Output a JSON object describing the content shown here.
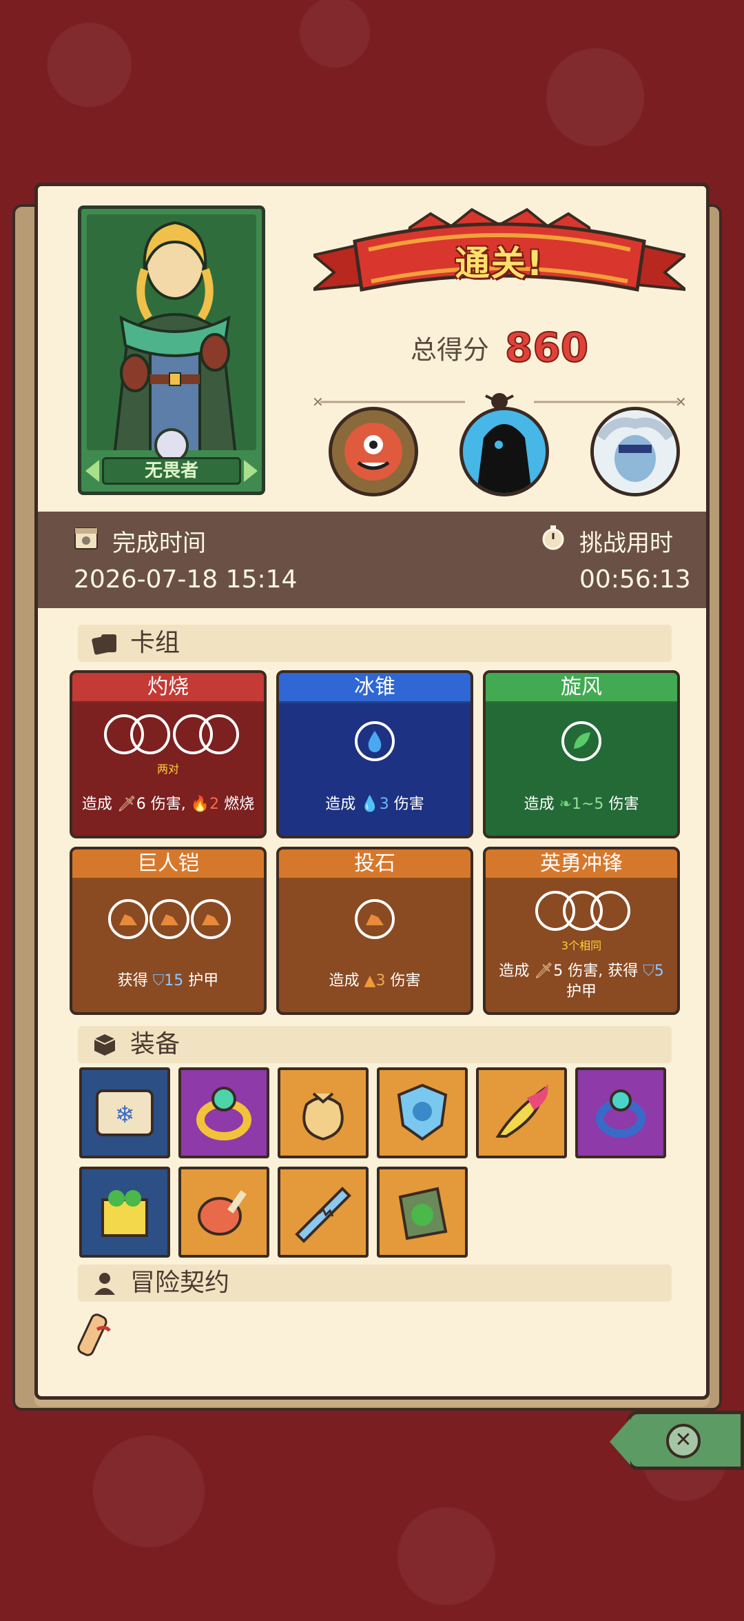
{
  "hero": {
    "name": "无畏者"
  },
  "result": {
    "banner": "通关!",
    "score_label": "总得分",
    "score": "860"
  },
  "stats": {
    "finish_time_label": "完成时间",
    "finish_time": "2026-07-18 15:14",
    "duration_label": "挑战用时",
    "duration": "00:56:13"
  },
  "deck": {
    "title": "卡组",
    "cards": [
      {
        "name": "灼烧",
        "color": "red",
        "sub": "两对",
        "desc_prefix": "造成",
        "value": "6",
        "desc_mid": "伤害,",
        "value2": "2",
        "desc_suffix": "燃烧"
      },
      {
        "name": "冰锥",
        "color": "blue",
        "desc_prefix": "造成",
        "value": "3",
        "desc_suffix": "伤害"
      },
      {
        "name": "旋风",
        "color": "green",
        "desc_prefix": "造成",
        "value": "1~5",
        "desc_suffix": "伤害"
      },
      {
        "name": "巨人铠",
        "color": "orange",
        "desc_prefix": "获得",
        "value": "15",
        "desc_suffix": "护甲"
      },
      {
        "name": "投石",
        "color": "orange",
        "desc_prefix": "造成",
        "value": "3",
        "desc_suffix": "伤害"
      },
      {
        "name": "英勇冲锋",
        "color": "orange",
        "sub": "3个相同",
        "desc_prefix": "造成",
        "value": "5",
        "desc_mid": "伤害, 获得",
        "value2": "5",
        "desc_suffix": "护甲"
      }
    ]
  },
  "equipment": {
    "title": "装备",
    "items": [
      {
        "icon": "snowflake-scroll-icon",
        "color": "#2c4f86"
      },
      {
        "icon": "emerald-ring-icon",
        "color": "#8e3aa8"
      },
      {
        "icon": "money-bag-icon",
        "color": "#e49a3a"
      },
      {
        "icon": "ice-shield-icon",
        "color": "#e49a3a"
      },
      {
        "icon": "fire-feather-icon",
        "color": "#e49a3a"
      },
      {
        "icon": "magic-ring-icon",
        "color": "#8e3aa8"
      },
      {
        "icon": "clover-block-icon",
        "color": "#2c4f86"
      },
      {
        "icon": "ham-icon",
        "color": "#e49a3a"
      },
      {
        "icon": "serrated-blade-icon",
        "color": "#e49a3a"
      },
      {
        "icon": "mossy-stone-icon",
        "color": "#e49a3a"
      }
    ]
  },
  "contract": {
    "title": "冒险契约"
  }
}
